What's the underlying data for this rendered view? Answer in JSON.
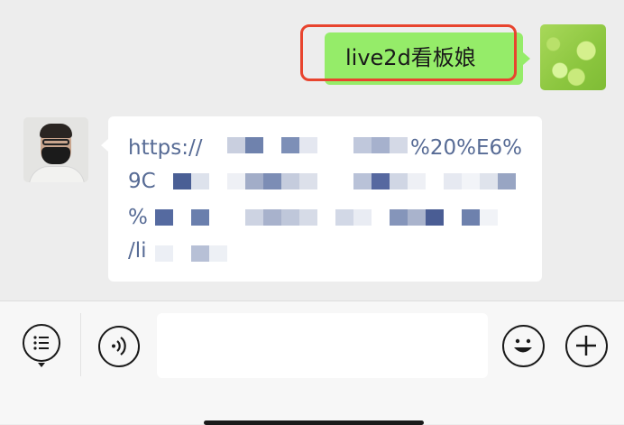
{
  "chat": {
    "outgoing_message": "live2d看板娘",
    "incoming_link_lines": [
      "https://",
      "9C",
      "%",
      "/li"
    ],
    "incoming_link_fragments": [
      "%20%E6%"
    ]
  },
  "colors": {
    "chat_background": "#ededed",
    "outgoing_bubble": "#95ec69",
    "incoming_bubble": "#ffffff",
    "link_text": "#576b95",
    "highlight_border": "#e8442e"
  },
  "input_bar": {
    "icons": [
      "list-menu-icon",
      "voice-icon",
      "emoji-icon",
      "plus-icon"
    ],
    "message_value": ""
  }
}
